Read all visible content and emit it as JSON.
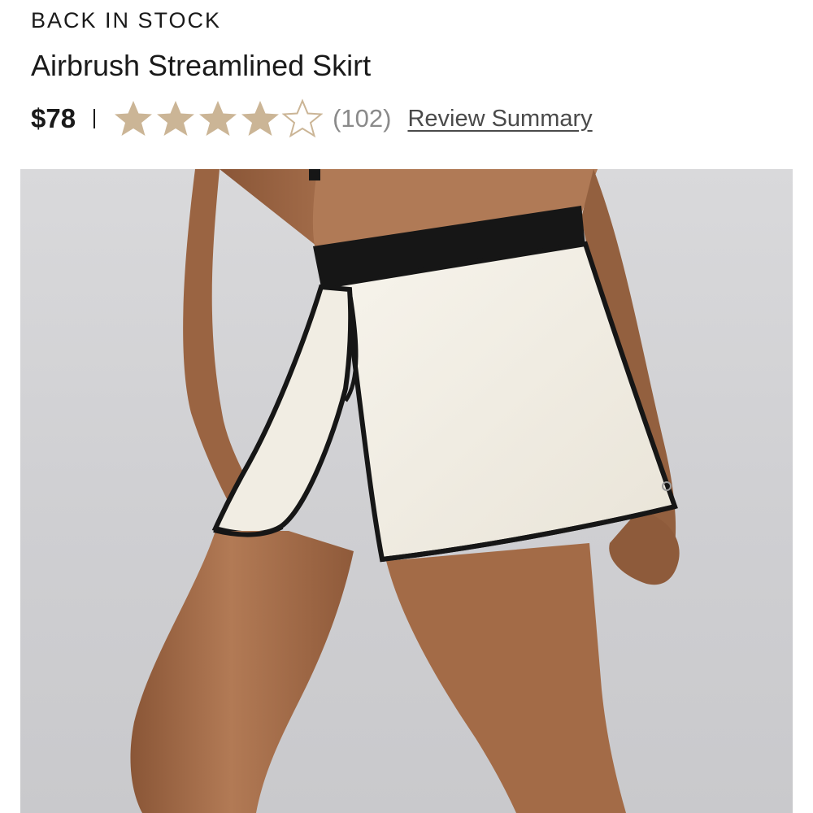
{
  "product": {
    "badge": "BACK IN STOCK",
    "title": "Airbrush Streamlined Skirt",
    "price": "$78",
    "rating": 4,
    "rating_max": 5,
    "review_count": "(102)",
    "review_link_label": "Review Summary"
  },
  "colors": {
    "star_filled": "#cbb596",
    "star_empty": "#cbb596",
    "skirt_body": "#f3efe6",
    "skirt_trim": "#161616",
    "skin": "#a9704c",
    "background": "#d3d3d6"
  },
  "icons": {
    "star_filled": "star-filled-icon",
    "star_empty": "star-outline-icon"
  }
}
